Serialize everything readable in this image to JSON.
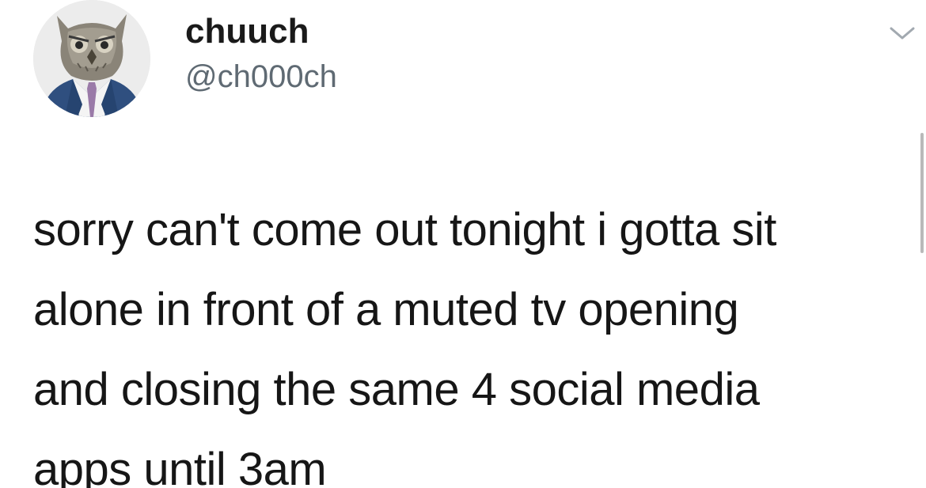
{
  "tweet": {
    "author": {
      "display_name": "chuuch",
      "handle": "@ch000ch",
      "avatar": "owl-in-suit-avatar"
    },
    "menu_icon": "chevron-down-icon",
    "text_lines": [
      "sorry can't come out tonight i gotta sit",
      "alone in front of a muted tv opening",
      "and closing the same 4 social media",
      "apps until 3am"
    ]
  },
  "colors": {
    "background": "#ffffff",
    "text": "#161616",
    "handle": "#5f6a73",
    "suit": "#2f4f7f",
    "tie": "#9a7aa8"
  }
}
